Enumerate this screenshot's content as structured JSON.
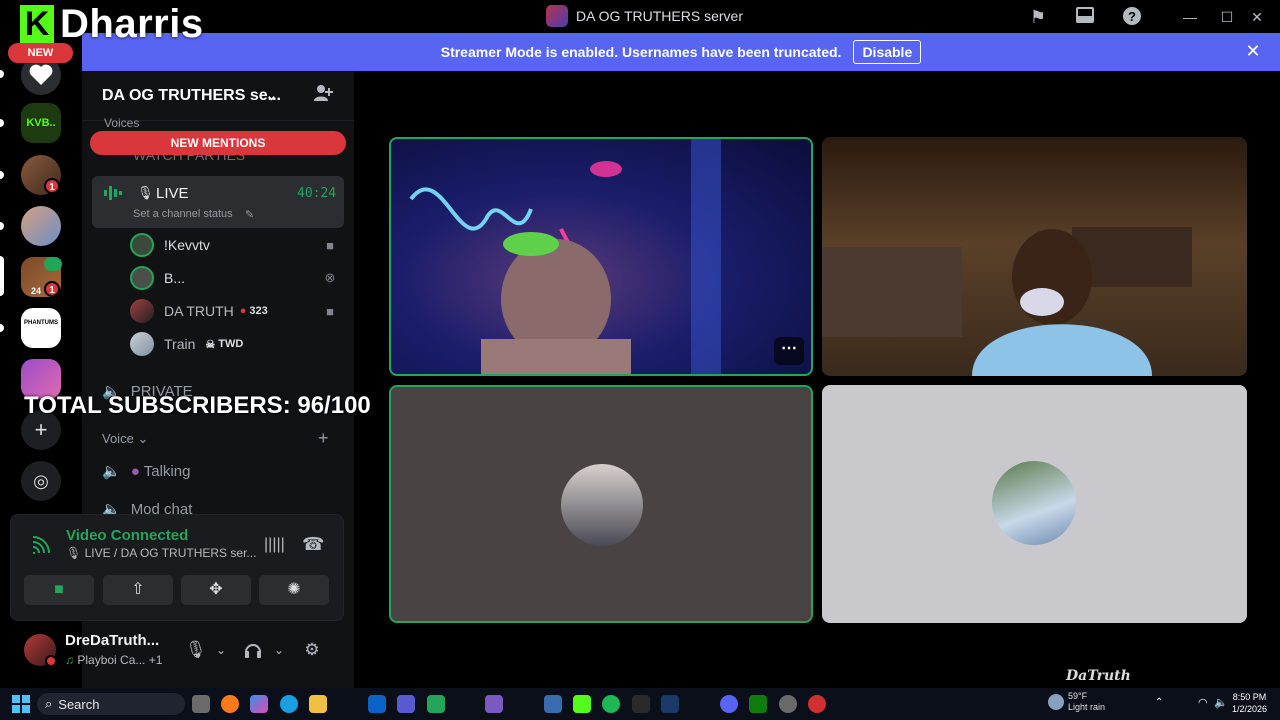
{
  "window": {
    "title": "DA OG TRUTHERS server"
  },
  "overlay": {
    "kick_letter": "K",
    "channel_name": "Dharris",
    "subscribers_text": "TOTAL SUBSCRIBERS: 96/100",
    "watermark": "DaTruth"
  },
  "banner": {
    "message": "Streamer Mode is enabled. Usernames have been truncated.",
    "button": "Disable"
  },
  "rail": {
    "new_label": "NEW",
    "kvb_label": "KVB..",
    "phantom_label": "PHANTUMS",
    "badges": [
      "1",
      "1"
    ],
    "small_count": "24"
  },
  "server": {
    "name": "DA OG TRUTHERS se..."
  },
  "channels": {
    "top_category": "Voices",
    "hidden_channel": "WATCH PARTIES",
    "new_mentions": "NEW MENTIONS",
    "live": {
      "name": "LIVE",
      "timer": "40:24",
      "status_placeholder": "Set a channel status"
    },
    "members": [
      {
        "name": "!Kevvtv",
        "chip": "",
        "icon": "video-icon"
      },
      {
        "name": "B...",
        "chip": "",
        "icon": "xbox-icon"
      },
      {
        "name": "DA TRUTH",
        "chip": "323",
        "icon": "video-icon"
      },
      {
        "name": "Train",
        "chip": "TWD",
        "icon": ""
      }
    ],
    "private": "PRIVATE",
    "voice_category": "Voice",
    "voice_channels": [
      "Talking",
      "Mod chat"
    ]
  },
  "voice_panel": {
    "status": "Video Connected",
    "location": "LIVE / DA OG TRUTHERS ser..."
  },
  "user_panel": {
    "name": "DreDaTruth...",
    "status": "Playboi Ca...",
    "extra": "+1"
  },
  "taskbar": {
    "search": "Search",
    "weather_temp": "59°F",
    "weather_desc": "Light rain",
    "time": "8:50 PM",
    "date": "1/2/2026"
  },
  "colors": {
    "kick_green": "#53fc18",
    "blurple": "#5865f2",
    "red": "#da373c",
    "speaking_green": "#23a55a"
  }
}
